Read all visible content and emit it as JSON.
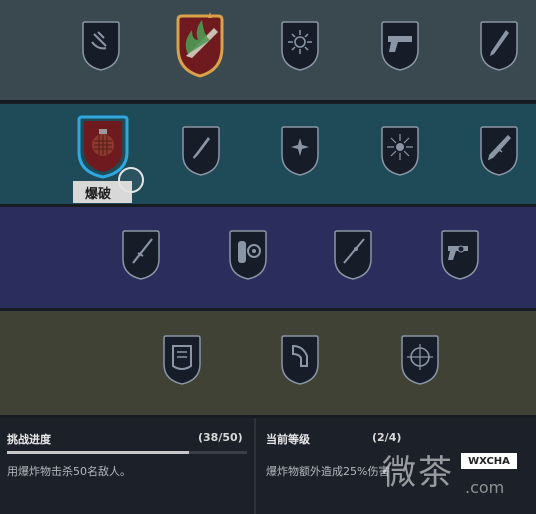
{
  "rows": [
    {
      "name": "row-1",
      "badges": [
        {
          "icon": "grenade-hand-icon",
          "state": "locked"
        },
        {
          "icon": "knife-emblem-icon",
          "state": "earned"
        },
        {
          "icon": "starburst-icon",
          "state": "locked"
        },
        {
          "icon": "pistol-icon",
          "state": "locked"
        },
        {
          "icon": "shotgun-icon",
          "state": "locked"
        }
      ]
    },
    {
      "name": "row-2",
      "badges": [
        {
          "icon": "grenade-icon",
          "state": "selected"
        },
        {
          "icon": "knife-icon",
          "state": "locked"
        },
        {
          "icon": "sparkle-icon",
          "state": "locked"
        },
        {
          "icon": "burst-icon",
          "state": "locked"
        },
        {
          "icon": "rifle-icon",
          "state": "locked"
        }
      ]
    },
    {
      "name": "row-3",
      "badges": [
        {
          "icon": "sniper-rifle-icon",
          "state": "locked"
        },
        {
          "icon": "drum-magazine-icon",
          "state": "locked"
        },
        {
          "icon": "long-rifle-icon",
          "state": "locked"
        },
        {
          "icon": "revolver-icon",
          "state": "locked"
        }
      ]
    },
    {
      "name": "row-4",
      "badges": [
        {
          "icon": "armor-vest-icon",
          "state": "locked"
        },
        {
          "icon": "knee-pad-icon",
          "state": "locked"
        },
        {
          "icon": "crosshair-icon",
          "state": "locked"
        }
      ]
    }
  ],
  "selected_label": "爆破",
  "progress": {
    "title": "挑战进度",
    "count": "(38/50)",
    "fraction": 0.76,
    "description": "用爆炸物击杀50名敌人。"
  },
  "level": {
    "title": "当前等级",
    "count": "(2/4)",
    "description": "爆炸物额外造成25%伤害"
  },
  "watermark": {
    "big": "微茶",
    "box": "WXCHA",
    "url": ".com"
  },
  "colors": {
    "badge_fill": "#161c28",
    "badge_stroke": "#8a96a6",
    "selected_ring": "#2fa8e0",
    "earned_gold": "#d8a24a",
    "earned_red": "#6e1a1e"
  }
}
